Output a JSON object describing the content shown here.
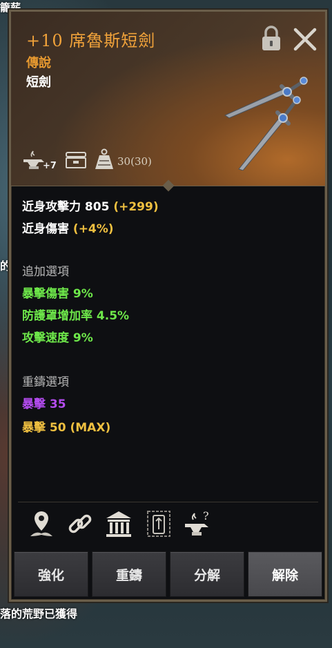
{
  "background": {
    "top_text": "籠薪",
    "left_text": "的",
    "bottom_text": "落的荒野",
    "bottom_suffix": "已獲得"
  },
  "item": {
    "title": "+10 席魯斯短劍",
    "grade": "傳說",
    "type": "短劍",
    "enhance_badge": "+7",
    "durability": "30(30)"
  },
  "stats": {
    "attack_label": "近身攻擊力 805",
    "attack_bonus": "(+299)",
    "damage_label": "近身傷害",
    "damage_bonus": "(+4%)"
  },
  "bonus_options": {
    "header": "追加選項",
    "items": [
      "暴擊傷害 9%",
      "防護罩增加率 4.5%",
      "攻擊速度 9%"
    ]
  },
  "reforge_options": {
    "header": "重鑄選項",
    "item1": "暴擊 35",
    "item2": "暴擊 50 (MAX)"
  },
  "buttons": {
    "enhance": "強化",
    "reforge": "重鑄",
    "dismantle": "分解",
    "unequip": "解除"
  },
  "icons": {
    "lock": "padlock-icon",
    "close": "close-icon",
    "anvil": "anvil-icon",
    "chest": "chest-icon",
    "weight": "weight-icon",
    "location": "location-pin-icon",
    "link": "chain-link-icon",
    "bank": "bank-icon",
    "card": "card-icon",
    "anvil_help": "anvil-help-icon"
  },
  "colors": {
    "title": "#f0a23a",
    "bonus": "#f0c040",
    "green": "#6ee84a",
    "purple": "#b44cf0"
  }
}
